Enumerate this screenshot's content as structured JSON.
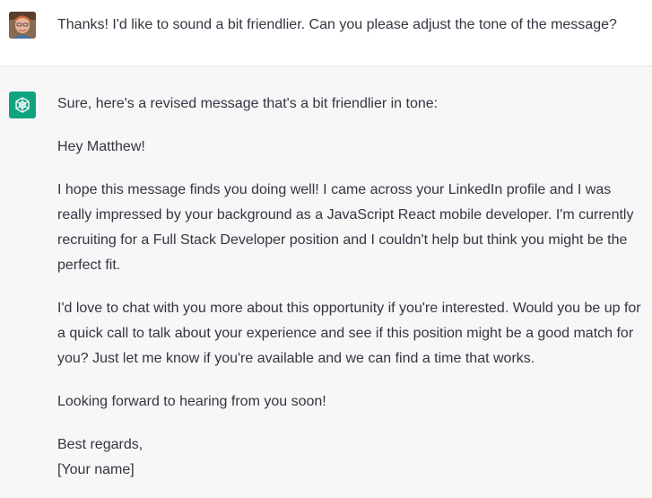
{
  "conversation": {
    "user_message": {
      "avatar": "user-avatar-photo",
      "text": "Thanks! I'd like to sound a bit friendlier. Can you please adjust the tone of the message?"
    },
    "assistant_message": {
      "avatar": "chatgpt-logo-icon",
      "accent_color": "#10a37f",
      "intro": "Sure, here's a revised message that's a bit friendlier in tone:",
      "greeting": "Hey Matthew!",
      "paragraph_1": "I hope this message finds you doing well! I came across your LinkedIn profile and I was really impressed by your background as a JavaScript React mobile developer. I'm currently recruiting for a Full Stack Developer position and I couldn't help but think you might be the perfect fit.",
      "paragraph_2": "I'd love to chat with you more about this opportunity if you're interested. Would you be up for a quick call to talk about your experience and see if this position might be a good match for you? Just let me know if you're available and we can find a time that works.",
      "closing_line": "Looking forward to hearing from you soon!",
      "sign_off": "Best regards,",
      "signature": "[Your name]"
    }
  }
}
